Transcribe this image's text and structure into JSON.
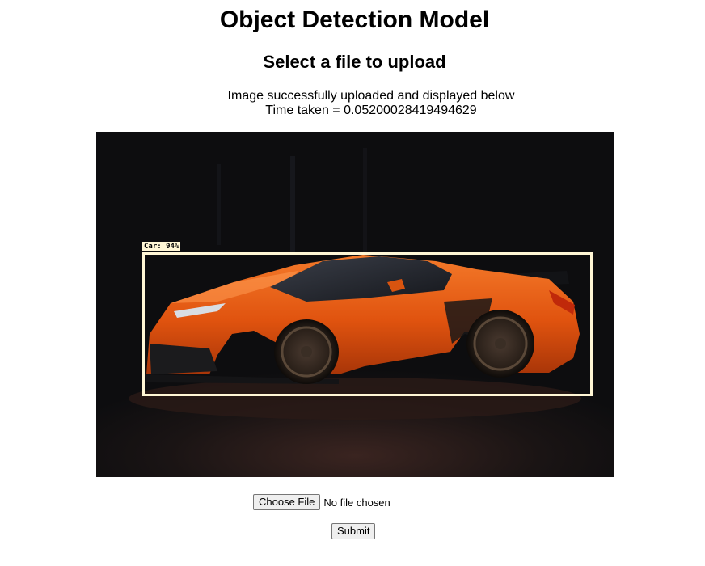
{
  "page": {
    "title": "Object Detection Model",
    "subtitle": "Select a file to upload"
  },
  "status": {
    "upload_message": "Image successfully uploaded and displayed below",
    "time_taken": "Time taken = 0.05200028419494629"
  },
  "detection": {
    "label": "Car: 94%",
    "class": "Car",
    "confidence_percent": 94,
    "box_color": "#fff6d5"
  },
  "form": {
    "choose_file_label": "Choose File",
    "file_status": "No file chosen",
    "submit_label": "Submit"
  },
  "colors": {
    "car_body": "#e85a12",
    "background": "#0d0d0f"
  }
}
